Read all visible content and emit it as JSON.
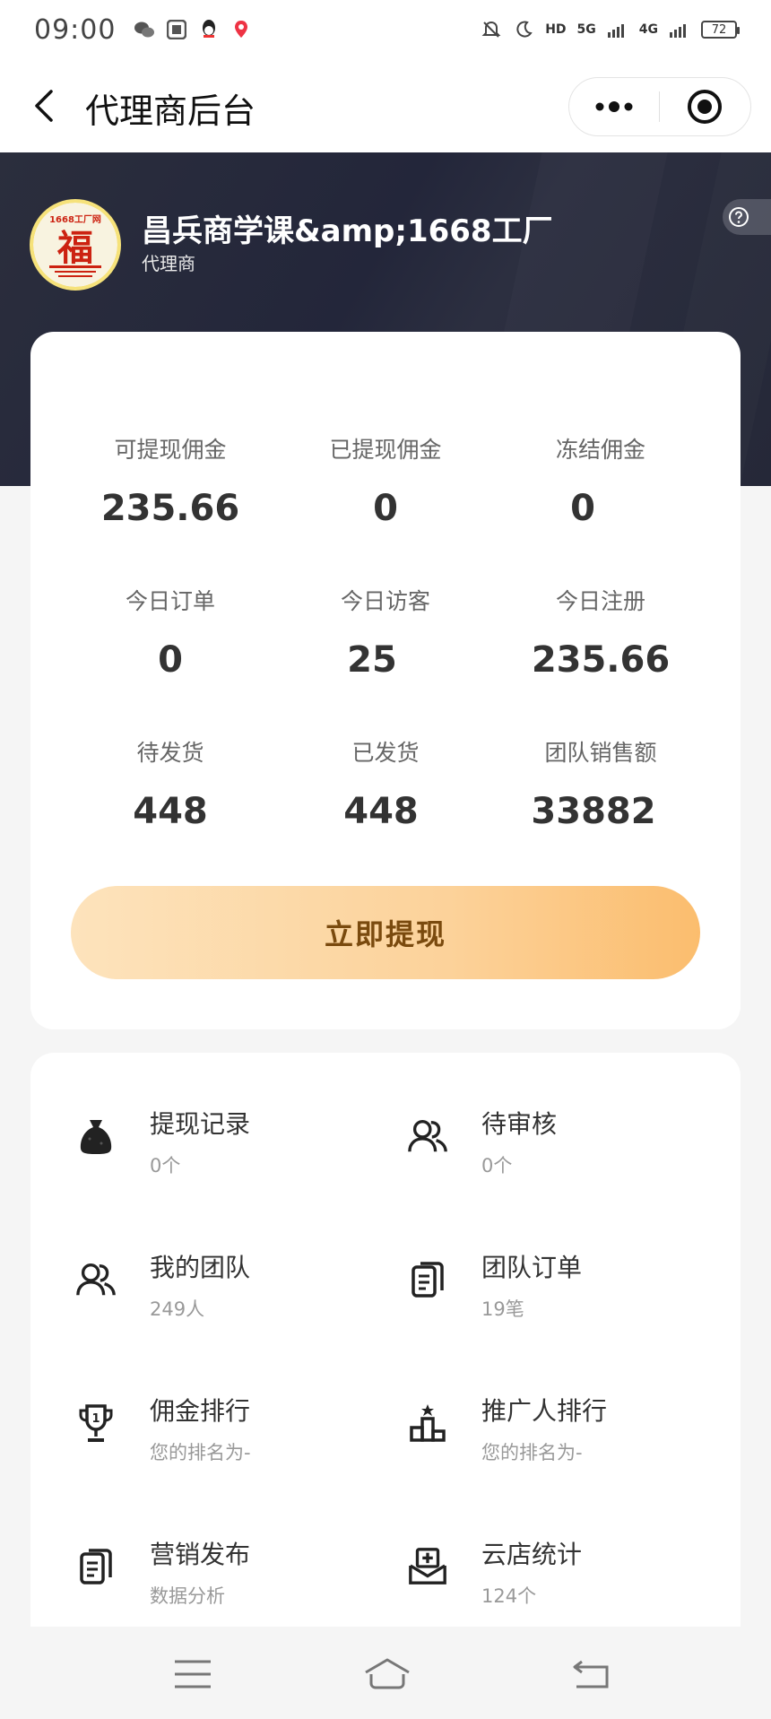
{
  "status_bar": {
    "time": "09:00",
    "network_1": "5G",
    "network_2": "4G",
    "battery": "72",
    "hd_label": "HD"
  },
  "nav": {
    "title": "代理商后台",
    "more_icon": "more-dots-icon",
    "close_icon": "target-close-icon"
  },
  "profile": {
    "name": "昌兵商学课&amp;1668工厂",
    "role": "代理商",
    "avatar_text": "福",
    "avatar_top_text": "1668工厂网"
  },
  "stats": [
    {
      "label": "可提现佣金",
      "value": "235.66"
    },
    {
      "label": "已提现佣金",
      "value": "0"
    },
    {
      "label": "冻结佣金",
      "value": "0"
    },
    {
      "label": "今日订单",
      "value": "0"
    },
    {
      "label": "今日访客",
      "value": "25"
    },
    {
      "label": "今日注册",
      "value": "235.66"
    },
    {
      "label": "待发货",
      "value": "448"
    },
    {
      "label": "已发货",
      "value": "448"
    },
    {
      "label": "团队销售额",
      "value": "33882"
    }
  ],
  "withdraw_button": "立即提现",
  "menu": [
    {
      "title": "提现记录",
      "sub": "0个",
      "icon": "money-bag-icon"
    },
    {
      "title": "待审核",
      "sub": "0个",
      "icon": "users-icon"
    },
    {
      "title": "我的团队",
      "sub": "249人",
      "icon": "team-icon"
    },
    {
      "title": "团队订单",
      "sub": "19笔",
      "icon": "documents-icon"
    },
    {
      "title": "佣金排行",
      "sub": "您的排名为-",
      "icon": "trophy-icon"
    },
    {
      "title": "推广人排行",
      "sub": "您的排名为-",
      "icon": "podium-icon"
    },
    {
      "title": "营销发布",
      "sub": "数据分析",
      "icon": "document-icon"
    },
    {
      "title": "云店统计",
      "sub": "124个",
      "icon": "inbox-plus-icon"
    }
  ],
  "colors": {
    "header_bg": "#262939",
    "button_start": "#fde3bc",
    "button_end": "#fbbd6e",
    "button_text": "#7a4a0e"
  }
}
